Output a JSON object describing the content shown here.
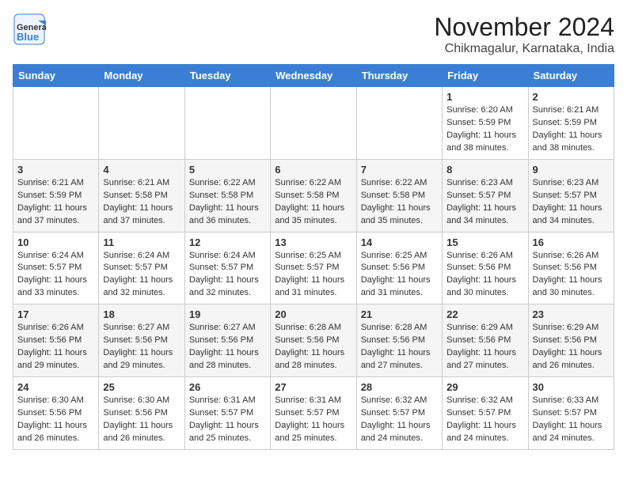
{
  "header": {
    "logo_general": "General",
    "logo_blue": "Blue",
    "month_title": "November 2024",
    "location": "Chikmagalur, Karnataka, India"
  },
  "calendar": {
    "headers": [
      "Sunday",
      "Monday",
      "Tuesday",
      "Wednesday",
      "Thursday",
      "Friday",
      "Saturday"
    ],
    "weeks": [
      [
        {
          "day": "",
          "info": ""
        },
        {
          "day": "",
          "info": ""
        },
        {
          "day": "",
          "info": ""
        },
        {
          "day": "",
          "info": ""
        },
        {
          "day": "",
          "info": ""
        },
        {
          "day": "1",
          "info": "Sunrise: 6:20 AM\nSunset: 5:59 PM\nDaylight: 11 hours\nand 38 minutes."
        },
        {
          "day": "2",
          "info": "Sunrise: 6:21 AM\nSunset: 5:59 PM\nDaylight: 11 hours\nand 38 minutes."
        }
      ],
      [
        {
          "day": "3",
          "info": "Sunrise: 6:21 AM\nSunset: 5:59 PM\nDaylight: 11 hours\nand 37 minutes."
        },
        {
          "day": "4",
          "info": "Sunrise: 6:21 AM\nSunset: 5:58 PM\nDaylight: 11 hours\nand 37 minutes."
        },
        {
          "day": "5",
          "info": "Sunrise: 6:22 AM\nSunset: 5:58 PM\nDaylight: 11 hours\nand 36 minutes."
        },
        {
          "day": "6",
          "info": "Sunrise: 6:22 AM\nSunset: 5:58 PM\nDaylight: 11 hours\nand 35 minutes."
        },
        {
          "day": "7",
          "info": "Sunrise: 6:22 AM\nSunset: 5:58 PM\nDaylight: 11 hours\nand 35 minutes."
        },
        {
          "day": "8",
          "info": "Sunrise: 6:23 AM\nSunset: 5:57 PM\nDaylight: 11 hours\nand 34 minutes."
        },
        {
          "day": "9",
          "info": "Sunrise: 6:23 AM\nSunset: 5:57 PM\nDaylight: 11 hours\nand 34 minutes."
        }
      ],
      [
        {
          "day": "10",
          "info": "Sunrise: 6:24 AM\nSunset: 5:57 PM\nDaylight: 11 hours\nand 33 minutes."
        },
        {
          "day": "11",
          "info": "Sunrise: 6:24 AM\nSunset: 5:57 PM\nDaylight: 11 hours\nand 32 minutes."
        },
        {
          "day": "12",
          "info": "Sunrise: 6:24 AM\nSunset: 5:57 PM\nDaylight: 11 hours\nand 32 minutes."
        },
        {
          "day": "13",
          "info": "Sunrise: 6:25 AM\nSunset: 5:57 PM\nDaylight: 11 hours\nand 31 minutes."
        },
        {
          "day": "14",
          "info": "Sunrise: 6:25 AM\nSunset: 5:56 PM\nDaylight: 11 hours\nand 31 minutes."
        },
        {
          "day": "15",
          "info": "Sunrise: 6:26 AM\nSunset: 5:56 PM\nDaylight: 11 hours\nand 30 minutes."
        },
        {
          "day": "16",
          "info": "Sunrise: 6:26 AM\nSunset: 5:56 PM\nDaylight: 11 hours\nand 30 minutes."
        }
      ],
      [
        {
          "day": "17",
          "info": "Sunrise: 6:26 AM\nSunset: 5:56 PM\nDaylight: 11 hours\nand 29 minutes."
        },
        {
          "day": "18",
          "info": "Sunrise: 6:27 AM\nSunset: 5:56 PM\nDaylight: 11 hours\nand 29 minutes."
        },
        {
          "day": "19",
          "info": "Sunrise: 6:27 AM\nSunset: 5:56 PM\nDaylight: 11 hours\nand 28 minutes."
        },
        {
          "day": "20",
          "info": "Sunrise: 6:28 AM\nSunset: 5:56 PM\nDaylight: 11 hours\nand 28 minutes."
        },
        {
          "day": "21",
          "info": "Sunrise: 6:28 AM\nSunset: 5:56 PM\nDaylight: 11 hours\nand 27 minutes."
        },
        {
          "day": "22",
          "info": "Sunrise: 6:29 AM\nSunset: 5:56 PM\nDaylight: 11 hours\nand 27 minutes."
        },
        {
          "day": "23",
          "info": "Sunrise: 6:29 AM\nSunset: 5:56 PM\nDaylight: 11 hours\nand 26 minutes."
        }
      ],
      [
        {
          "day": "24",
          "info": "Sunrise: 6:30 AM\nSunset: 5:56 PM\nDaylight: 11 hours\nand 26 minutes."
        },
        {
          "day": "25",
          "info": "Sunrise: 6:30 AM\nSunset: 5:56 PM\nDaylight: 11 hours\nand 26 minutes."
        },
        {
          "day": "26",
          "info": "Sunrise: 6:31 AM\nSunset: 5:57 PM\nDaylight: 11 hours\nand 25 minutes."
        },
        {
          "day": "27",
          "info": "Sunrise: 6:31 AM\nSunset: 5:57 PM\nDaylight: 11 hours\nand 25 minutes."
        },
        {
          "day": "28",
          "info": "Sunrise: 6:32 AM\nSunset: 5:57 PM\nDaylight: 11 hours\nand 24 minutes."
        },
        {
          "day": "29",
          "info": "Sunrise: 6:32 AM\nSunset: 5:57 PM\nDaylight: 11 hours\nand 24 minutes."
        },
        {
          "day": "30",
          "info": "Sunrise: 6:33 AM\nSunset: 5:57 PM\nDaylight: 11 hours\nand 24 minutes."
        }
      ]
    ]
  }
}
